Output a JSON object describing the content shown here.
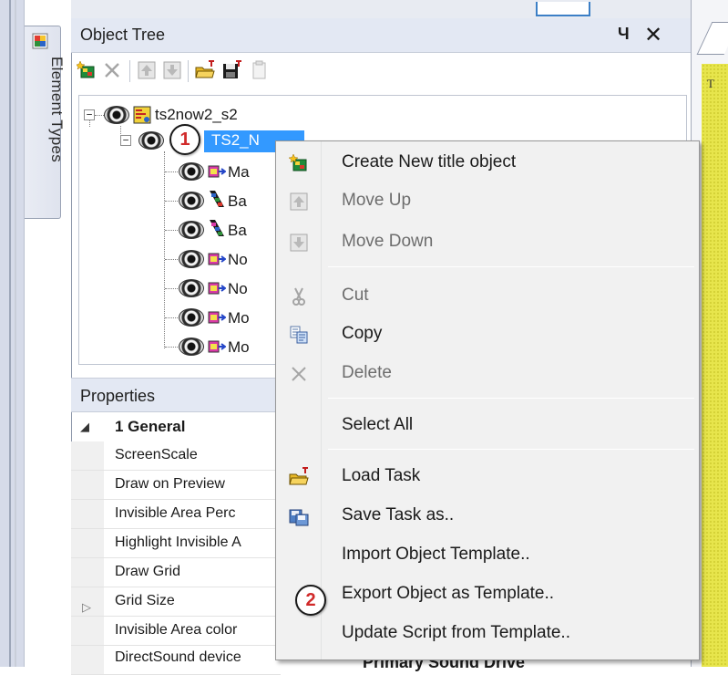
{
  "left_tab": {
    "label": "Element Types"
  },
  "object_tree": {
    "title": "Object Tree",
    "pin": "Ч",
    "close": "✕",
    "toolbar": [
      "create-new-object-icon",
      "delete-icon",
      "move-up-icon",
      "move-down-icon",
      "load-task-icon",
      "save-task-icon",
      "copy-clipboard-icon"
    ],
    "nodes": {
      "root": "ts2now2_s2",
      "selected": "TS2_N",
      "children": [
        "Ma",
        "Ba",
        "Ba",
        "No",
        "No",
        "Mo",
        "Mo"
      ]
    }
  },
  "right_doc": {
    "letter": "T"
  },
  "properties": {
    "title": "Properties",
    "category": "1 General",
    "rows": [
      "ScreenScale",
      "Draw on Preview",
      "Invisible Area Perc",
      "Highlight Invisible A",
      "Draw Grid",
      "Grid Size",
      "Invisible Area color",
      "DirectSound device"
    ],
    "value_partial": "Primary Sound Drive"
  },
  "context_menu": {
    "items": [
      {
        "label": "Create New title object",
        "icon": "create-new-object-icon",
        "enabled": true
      },
      {
        "label": "Move Up",
        "icon": "move-up-icon",
        "enabled": false
      },
      {
        "label": "Move Down",
        "icon": "move-down-icon",
        "enabled": false
      },
      {
        "label": "Cut",
        "icon": "scissors-icon",
        "enabled": false
      },
      {
        "label": "Copy",
        "icon": "copy-icon",
        "enabled": true
      },
      {
        "label": "Delete",
        "icon": "delete-icon",
        "enabled": false
      },
      {
        "label": "Select All",
        "icon": "",
        "enabled": true
      },
      {
        "label": "Load Task",
        "icon": "load-task-icon",
        "enabled": true
      },
      {
        "label": "Save Task as..",
        "icon": "save-task-icon",
        "enabled": true
      },
      {
        "label": "Import Object Template..",
        "icon": "",
        "enabled": true
      },
      {
        "label": "Export Object as Template..",
        "icon": "",
        "enabled": true
      },
      {
        "label": "Update Script from Template..",
        "icon": "",
        "enabled": true
      }
    ]
  },
  "callouts": {
    "first": "1",
    "second": "2"
  },
  "colors": {
    "selection": "#3399ff",
    "callout_text": "#d12a2a",
    "menu_bg": "#f1f1f1",
    "panel_header": "#e3e8f3"
  }
}
